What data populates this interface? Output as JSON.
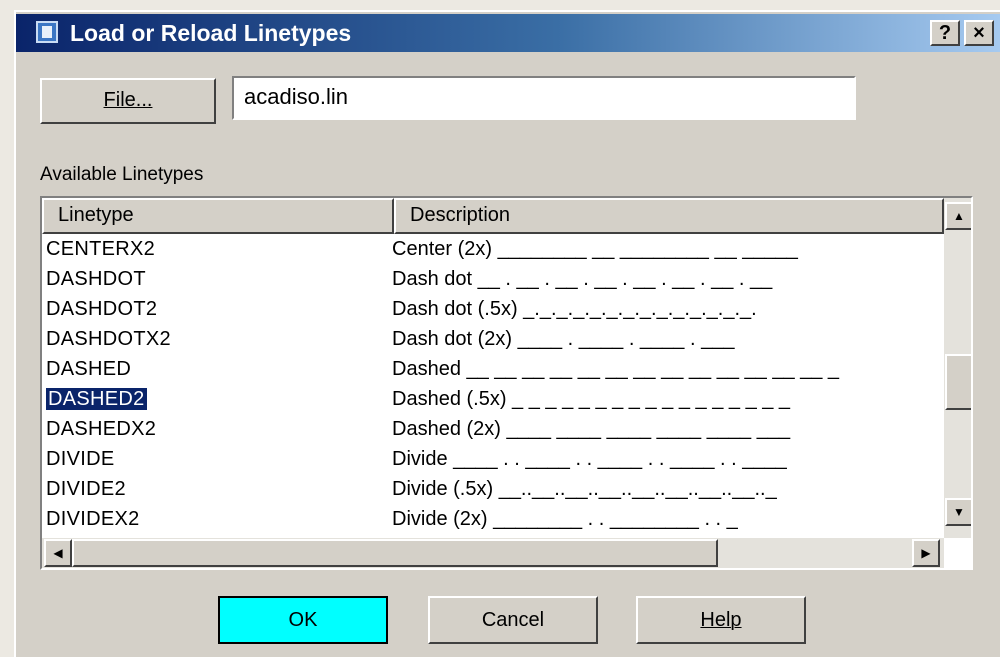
{
  "dialog": {
    "title": "Load or Reload Linetypes",
    "help_glyph": "?",
    "close_glyph": "×"
  },
  "file": {
    "button_label": "File...",
    "value": "acadiso.lin"
  },
  "available_label": "Available Linetypes",
  "columns": {
    "linetype": "Linetype",
    "description": "Description"
  },
  "rows": [
    {
      "name": "CENTERX2",
      "desc": "Center (2x) ________  __  ________  __  _____"
    },
    {
      "name": "DASHDOT",
      "desc": "Dash dot __ . __ . __ . __ . __ . __ . __ . __"
    },
    {
      "name": "DASHDOT2",
      "desc": "Dash dot (.5x) _._._._._._._._._._._._._._."
    },
    {
      "name": "DASHDOTX2",
      "desc": "Dash dot (2x) ____  .  ____  .  ____  .  ___"
    },
    {
      "name": "DASHED",
      "desc": "Dashed __ __ __ __ __ __ __ __ __ __ __ __ __ _"
    },
    {
      "name": "DASHED2",
      "desc": "Dashed (.5x) _ _ _ _ _ _ _ _ _ _ _ _ _ _ _ _ _"
    },
    {
      "name": "DASHEDX2",
      "desc": "Dashed (2x) ____  ____  ____  ____  ____  ___"
    },
    {
      "name": "DIVIDE",
      "desc": "Divide ____ . . ____ . . ____ . . ____ . . ____"
    },
    {
      "name": "DIVIDE2",
      "desc": "Divide (.5x) __..__..__..__..__..__..__..__.._"
    },
    {
      "name": "DIVIDEX2",
      "desc": "Divide (2x) ________  . .  ________  . .  _"
    }
  ],
  "selected_row": "DASHED2",
  "buttons": {
    "ok": "OK",
    "cancel": "Cancel",
    "help": "Help"
  },
  "colors": {
    "ok_button": "#00ffff",
    "selection": "#0a246a"
  }
}
